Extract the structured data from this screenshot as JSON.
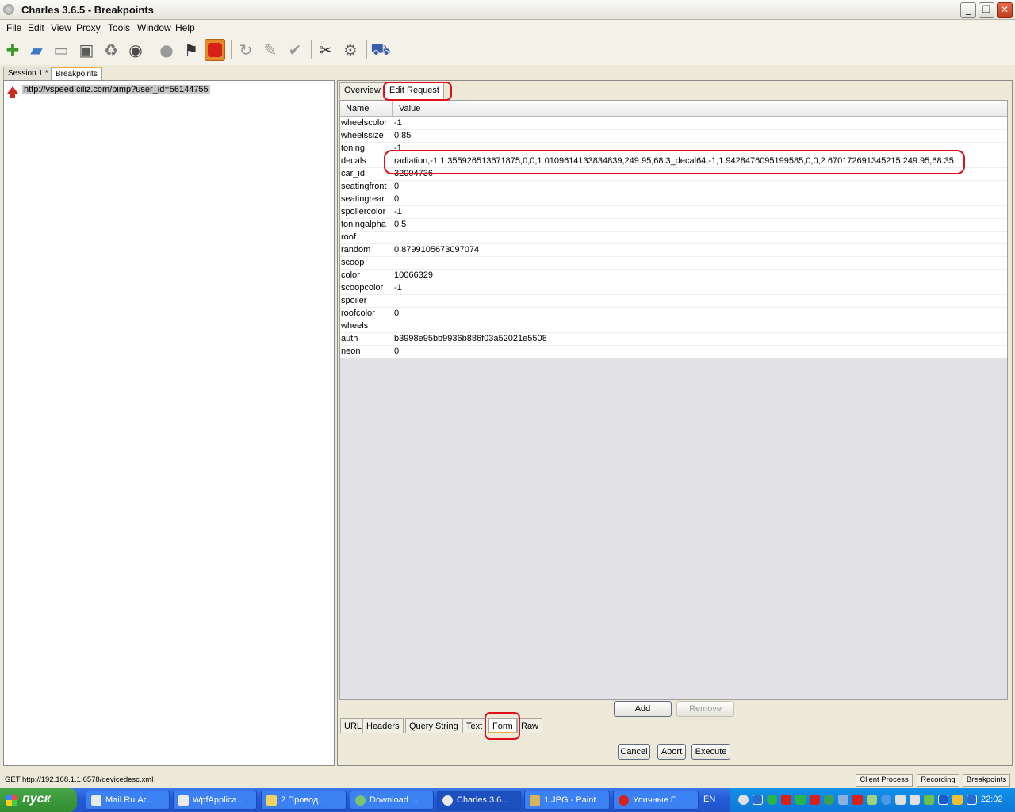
{
  "window": {
    "title": "Charles 3.6.5 - Breakpoints",
    "minimize": "_",
    "restore": "❐",
    "close": "✕"
  },
  "menu": [
    "File",
    "Edit",
    "View",
    "Proxy",
    "Tools",
    "Window",
    "Help"
  ],
  "toolbar_icons": [
    "new-session-icon",
    "open-icon",
    "close-session-icon",
    "save-icon",
    "clear-icon",
    "find-icon",
    "record-icon",
    "throttle-icon",
    "breakpoints-icon",
    "repeat-icon",
    "edit-icon",
    "validate-icon",
    "tools-icon",
    "settings-icon",
    "shop-icon"
  ],
  "session_tabs": [
    "Session 1 *",
    "Breakpoints"
  ],
  "tree": {
    "item": "http://vspeed.ciliz.com/pimp?user_id=56144755"
  },
  "top_tabs": [
    "Overview",
    "Edit Request"
  ],
  "table": {
    "headers": {
      "name": "Name",
      "value": "Value"
    },
    "rows": [
      {
        "name": "wheelscolor",
        "value": "-1"
      },
      {
        "name": "wheelssize",
        "value": "0.85"
      },
      {
        "name": "toning",
        "value": "-1"
      },
      {
        "name": "decals",
        "value": "radiation,-1,1.355926513671875,0,0,1.0109614133834839,249.95,68.3_decal64,-1,1.9428476095199585,0,0,2.670172691345215,249.95,68.35"
      },
      {
        "name": "car_id",
        "value": "32004736"
      },
      {
        "name": "seatingfront",
        "value": "0"
      },
      {
        "name": "seatingrear",
        "value": "0"
      },
      {
        "name": "spoilercolor",
        "value": "-1"
      },
      {
        "name": "toningalpha",
        "value": "0.5"
      },
      {
        "name": "roof",
        "value": ""
      },
      {
        "name": "random",
        "value": "0.8799105673097074"
      },
      {
        "name": "scoop",
        "value": ""
      },
      {
        "name": "color",
        "value": "10066329"
      },
      {
        "name": "scoopcolor",
        "value": "-1"
      },
      {
        "name": "spoiler",
        "value": ""
      },
      {
        "name": "roofcolor",
        "value": "0"
      },
      {
        "name": "wheels",
        "value": ""
      },
      {
        "name": "auth",
        "value": "b3998e95bb9936b886f03a52021e5508"
      },
      {
        "name": "neon",
        "value": "0"
      }
    ]
  },
  "table_buttons": {
    "add": "Add",
    "remove": "Remove"
  },
  "bottom_tabs": [
    "URL",
    "Headers",
    "Query String",
    "Text",
    "Form",
    "Raw"
  ],
  "action_buttons": {
    "cancel": "Cancel",
    "abort": "Abort",
    "execute": "Execute"
  },
  "status": {
    "text": "GET http://192.168.1.1:6578/devicedesc.xml",
    "buttons": [
      "Client Process",
      "Recording",
      "Breakpoints"
    ]
  },
  "taskbar": {
    "start": "пуск",
    "tasks": [
      "Mail.Ru Аг...",
      "WpfApplica...",
      "2 Провод...",
      "Download ...",
      "Charles 3.6...",
      "1.JPG - Paint",
      "Уличные Г..."
    ],
    "lang": "EN",
    "clock": "22:02"
  },
  "colors": {
    "highlight": "#e0101a",
    "active_tab_accent": "#f3a93a",
    "taskbar": "#245cd9"
  }
}
